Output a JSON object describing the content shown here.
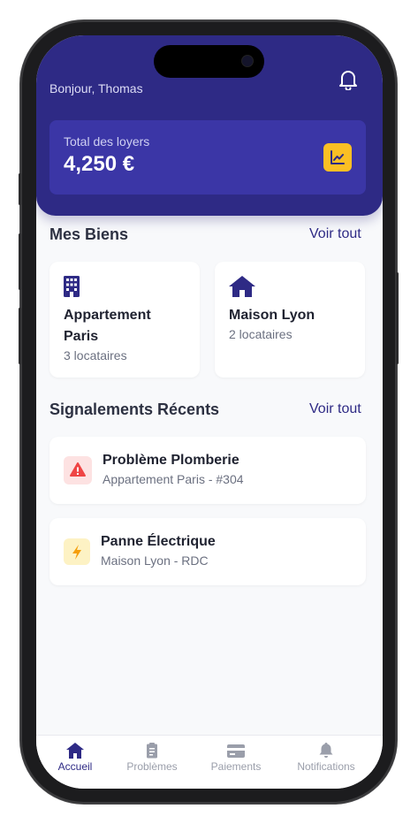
{
  "header": {
    "greeting": "Bonjour, Thomas",
    "total_label": "Total des loyers",
    "total_value": "4,250 €"
  },
  "properties": {
    "title": "Mes Biens",
    "see_all": "Voir tout",
    "items": [
      {
        "name": "Appartement Paris",
        "tenants": "3 locataires",
        "icon": "building-icon"
      },
      {
        "name": "Maison Lyon",
        "tenants": "2 locataires",
        "icon": "house-icon"
      }
    ]
  },
  "reports": {
    "title": "Signalements Récents",
    "see_all": "Voir tout",
    "items": [
      {
        "title": "Problème Plomberie",
        "location": "Appartement Paris - #304",
        "icon": "warning-icon",
        "color": "#ef4444",
        "bg": "#fde2e2"
      },
      {
        "title": "Panne Électrique",
        "location": "Maison Lyon - RDC",
        "icon": "bolt-icon",
        "color": "#f59e0b",
        "bg": "#fdf2c4"
      }
    ]
  },
  "tabs": [
    {
      "label": "Accueil",
      "icon": "home-icon",
      "active": true
    },
    {
      "label": "Problèmes",
      "icon": "clipboard-icon",
      "active": false
    },
    {
      "label": "Paiements",
      "icon": "card-icon",
      "active": false
    },
    {
      "label": "Notifications",
      "icon": "bell-icon",
      "active": false
    }
  ],
  "colors": {
    "primary": "#2e2a85",
    "accent": "#fbbf24",
    "background": "#f8f9fb"
  }
}
